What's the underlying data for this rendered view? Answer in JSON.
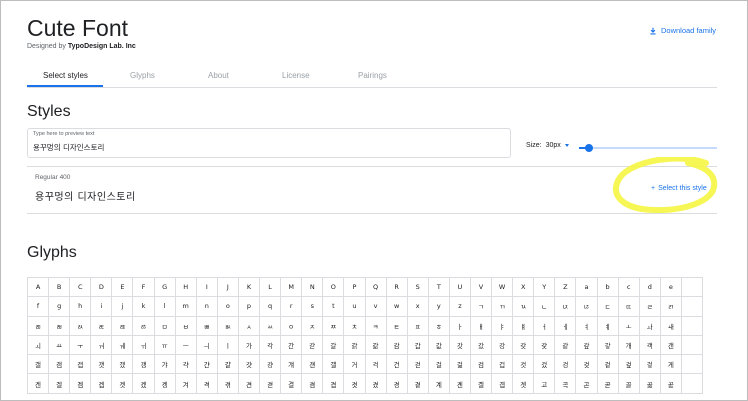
{
  "header": {
    "font_name": "Cute Font",
    "designed_by_prefix": "Designed by",
    "designer": "TypoDesign Lab. Inc",
    "download_label": "Download family"
  },
  "tabs": [
    {
      "label": "Select styles",
      "active": true
    },
    {
      "label": "Glyphs",
      "active": false
    },
    {
      "label": "About",
      "active": false
    },
    {
      "label": "License",
      "active": false
    },
    {
      "label": "Pairings",
      "active": false
    }
  ],
  "styles_section": {
    "heading": "Styles",
    "preview_placeholder": "Type here to preview text",
    "preview_text": "용꾸멍의 디자인스토리",
    "size_label": "Size:",
    "size_value": "30px",
    "size_slider_fraction": 0.07,
    "style_rows": [
      {
        "name": "Regular 400",
        "sample": "용꾸멍의 디자인스토리",
        "action_label": "Select this style"
      }
    ]
  },
  "glyphs_section": {
    "heading": "Glyphs",
    "rows": [
      [
        "A",
        "B",
        "C",
        "D",
        "E",
        "F",
        "G",
        "H",
        "I",
        "J",
        "K",
        "L",
        "M",
        "N",
        "O",
        "P",
        "Q",
        "R",
        "S",
        "T",
        "U",
        "V",
        "W",
        "X",
        "Y",
        "Z",
        "a",
        "b",
        "c",
        "d",
        "e"
      ],
      [
        "f",
        "g",
        "h",
        "i",
        "j",
        "k",
        "l",
        "m",
        "n",
        "o",
        "p",
        "q",
        "r",
        "s",
        "t",
        "u",
        "v",
        "w",
        "x",
        "y",
        "z",
        "ㄱ",
        "ㄲ",
        "ㄳ",
        "ㄴ",
        "ㄵ",
        "ㄶ",
        "ㄷ",
        "ㄸ",
        "ㄹ",
        "ㄺ"
      ],
      [
        "ㄻ",
        "ㄼ",
        "ㄽ",
        "ㄾ",
        "ㄿ",
        "ㅀ",
        "ㅁ",
        "ㅂ",
        "ㅃ",
        "ㅄ",
        "ㅅ",
        "ㅆ",
        "ㅇ",
        "ㅈ",
        "ㅉ",
        "ㅊ",
        "ㅋ",
        "ㅌ",
        "ㅍ",
        "ㅎ",
        "ㅏ",
        "ㅐ",
        "ㅑ",
        "ㅒ",
        "ㅓ",
        "ㅔ",
        "ㅕ",
        "ㅖ",
        "ㅗ",
        "ㅘ",
        "ㅙ"
      ],
      [
        "ㅚ",
        "ㅛ",
        "ㅜ",
        "ㅝ",
        "ㅞ",
        "ㅟ",
        "ㅠ",
        "ㅡ",
        "ㅢ",
        "ㅣ",
        "가",
        "각",
        "간",
        "갇",
        "갈",
        "갉",
        "갊",
        "감",
        "갑",
        "값",
        "갓",
        "갔",
        "강",
        "갖",
        "갗",
        "같",
        "갚",
        "갛",
        "개",
        "객",
        "갠"
      ],
      [
        "갤",
        "갬",
        "갭",
        "갯",
        "갰",
        "갱",
        "갸",
        "갹",
        "갼",
        "걀",
        "걋",
        "걍",
        "걔",
        "걘",
        "걜",
        "거",
        "걱",
        "건",
        "걷",
        "걸",
        "걺",
        "검",
        "겁",
        "것",
        "겄",
        "겅",
        "겆",
        "겉",
        "겊",
        "겋",
        "게"
      ],
      [
        "겐",
        "겔",
        "겜",
        "겝",
        "겟",
        "겠",
        "겡",
        "겨",
        "격",
        "겪",
        "견",
        "겯",
        "결",
        "겸",
        "겹",
        "겻",
        "겼",
        "경",
        "곁",
        "계",
        "곈",
        "곌",
        "곕",
        "곗",
        "고",
        "곡",
        "곤",
        "곧",
        "골",
        "곪",
        "곬"
      ]
    ]
  }
}
